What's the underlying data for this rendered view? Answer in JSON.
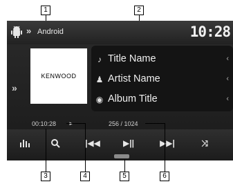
{
  "callouts": [
    "1",
    "2",
    "3",
    "4",
    "5",
    "6"
  ],
  "header": {
    "source_icon": "android-icon",
    "arrow": "»",
    "source_name": "Android",
    "clock": "10:28"
  },
  "side_arrow": "»",
  "artwork": {
    "logo_text": "KENWOOD"
  },
  "track_info": {
    "title": "Title Name",
    "artist": "Artist Name",
    "album": "Album Title",
    "title_icon": "music-note-icon",
    "artist_icon": "person-icon",
    "album_icon": "disc-icon",
    "more": "‹"
  },
  "status": {
    "elapsed": "00:10:28",
    "play_state": "►",
    "track_count": "256 / 1024"
  },
  "controls": {
    "eq": "equalizer-icon",
    "search": "search-icon",
    "prev": "previous-icon",
    "play_pause": "play-pause-icon",
    "next": "next-icon",
    "shuffle": "shuffle-icon"
  }
}
